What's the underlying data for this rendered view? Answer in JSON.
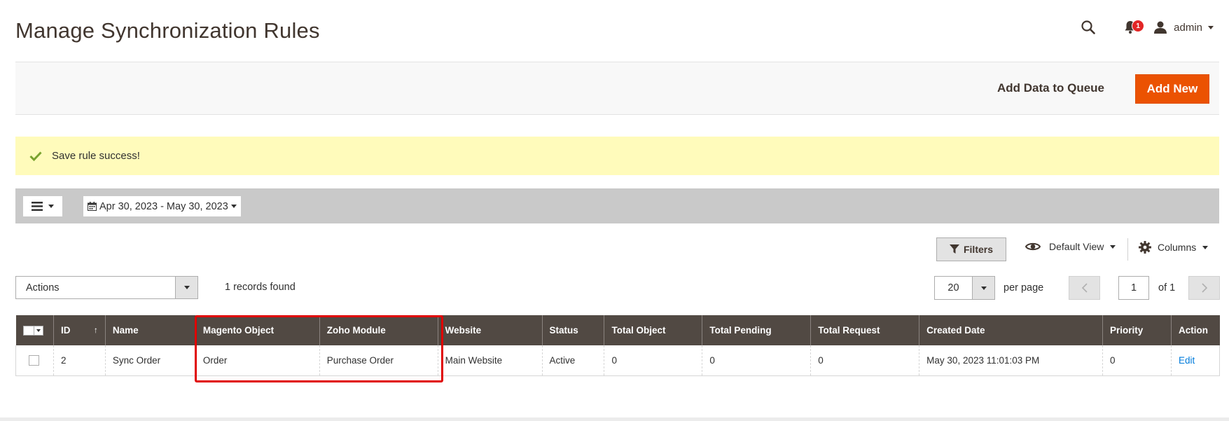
{
  "header": {
    "title": "Manage Synchronization Rules",
    "notifications_count": "1",
    "user_name": "admin"
  },
  "page_actions": {
    "queue_label": "Add Data to Queue",
    "add_new_label": "Add New"
  },
  "message": {
    "text": "Save rule success!",
    "type": "success"
  },
  "toolbar": {
    "date_range": "Apr 30, 2023 - May 30, 2023"
  },
  "controls": {
    "filters_label": "Filters",
    "view_label": "Default View",
    "columns_label": "Columns",
    "actions_label": "Actions",
    "records_found": "1 records found",
    "per_page_value": "20",
    "per_page_label": "per page",
    "current_page": "1",
    "total_pages_label": "of 1"
  },
  "grid": {
    "sort_indicator": "↑",
    "columns": [
      "ID",
      "Name",
      "Magento Object",
      "Zoho Module",
      "Website",
      "Status",
      "Total Object",
      "Total Pending",
      "Total Request",
      "Created Date",
      "Priority",
      "Action"
    ],
    "rows": [
      {
        "id": "2",
        "name": "Sync Order",
        "magento_object": "Order",
        "zoho_module": "Purchase Order",
        "website": "Main Website",
        "status": "Active",
        "total_object": "0",
        "total_pending": "0",
        "total_request": "0",
        "created_date": "May 30, 2023 11:01:03 PM",
        "priority": "0",
        "action": "Edit"
      }
    ]
  },
  "colors": {
    "accent": "#eb5202",
    "table_header": "#514943",
    "message_bg": "#fffbbb",
    "highlight": "#e00000",
    "link": "#007bdb"
  }
}
